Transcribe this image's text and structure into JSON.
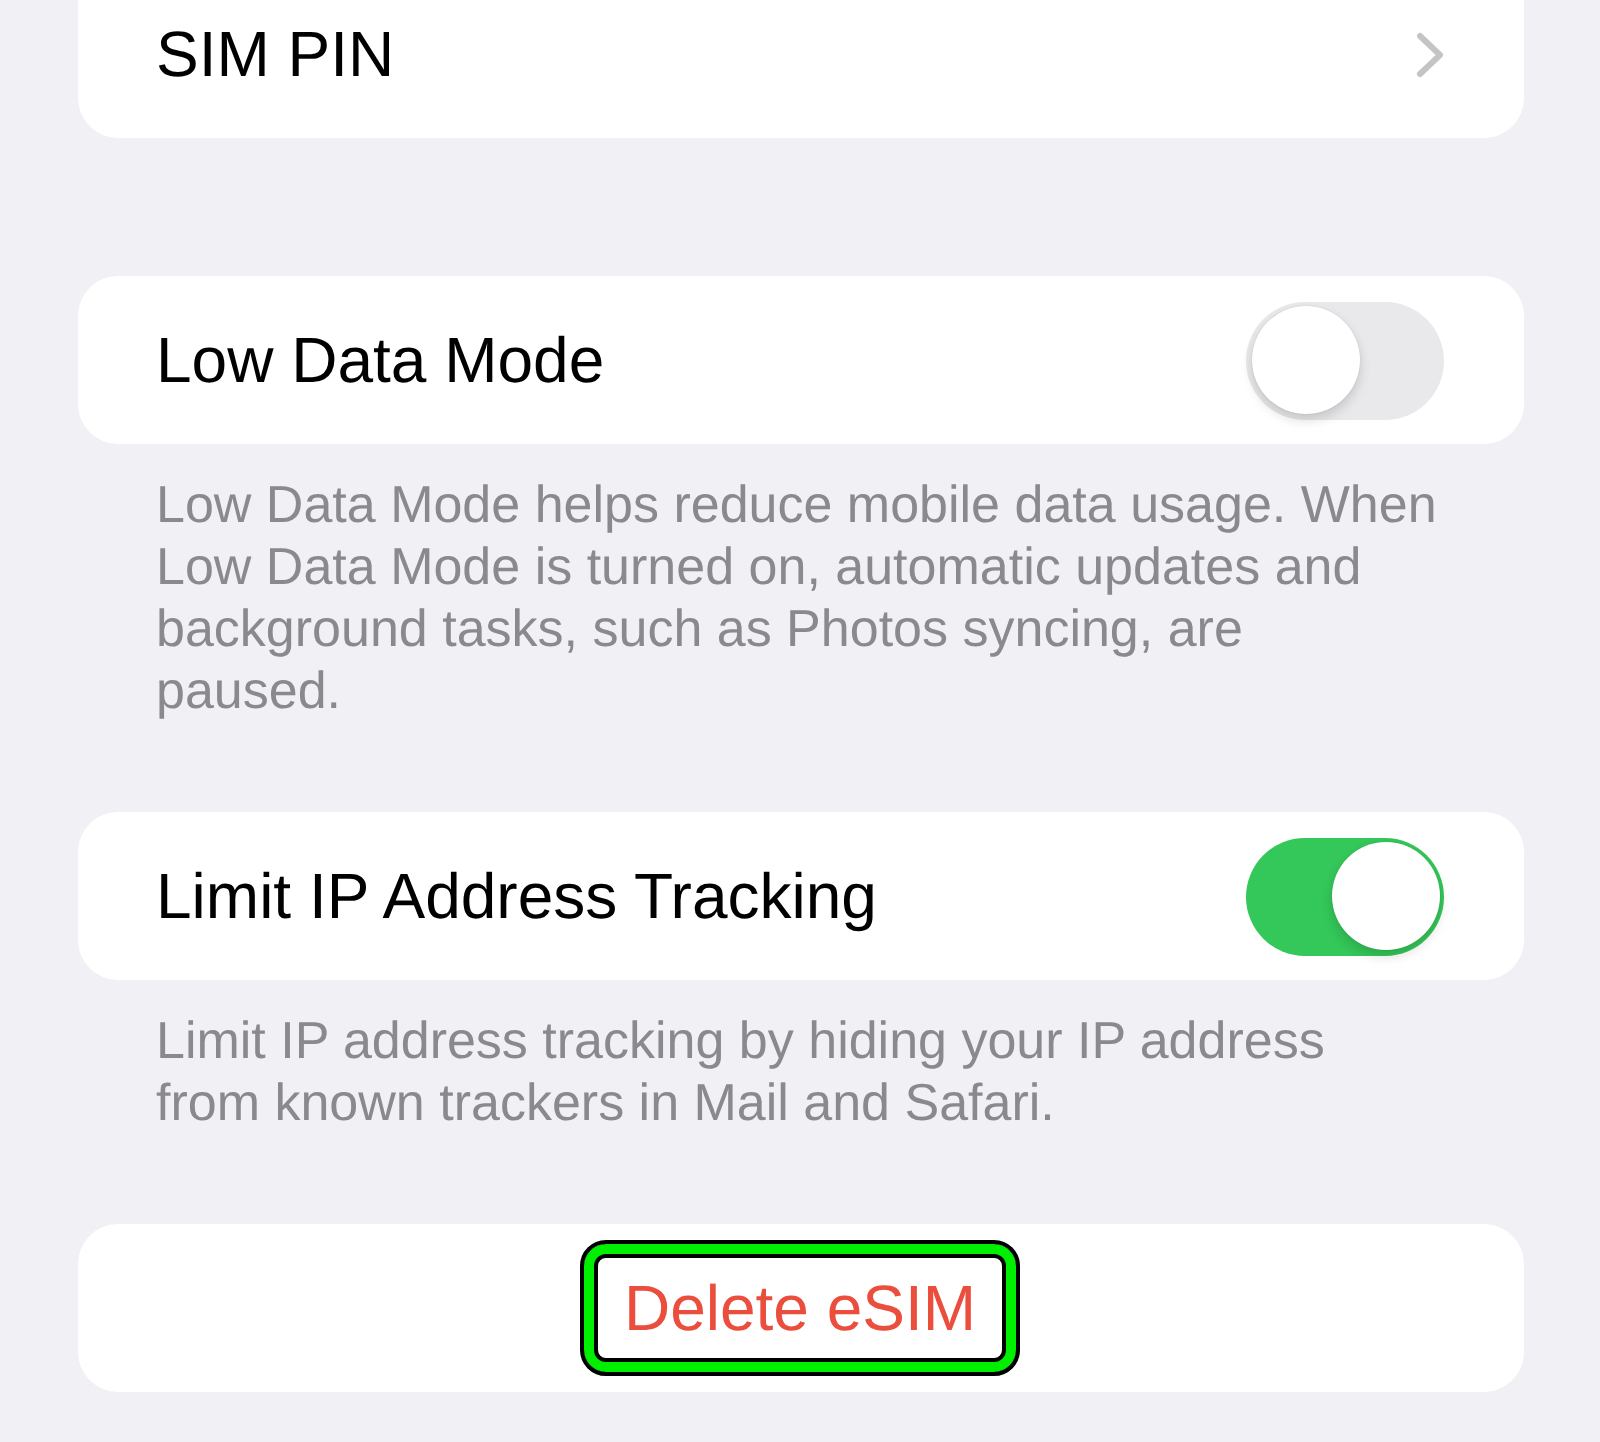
{
  "sections": [
    {
      "kind": "link",
      "label": "SIM PIN"
    },
    {
      "kind": "toggle",
      "label": "Low Data Mode",
      "on": false,
      "footer": "Low Data Mode helps reduce mobile data usage. When Low Data Mode is turned on, automatic updates and background tasks, such as Photos syncing, are paused."
    },
    {
      "kind": "toggle",
      "label": "Limit IP Address Tracking",
      "on": true,
      "footer": "Limit IP address tracking by hiding your IP address from known trackers in Mail and Safari."
    },
    {
      "kind": "action",
      "label": "Delete eSIM",
      "highlighted": true
    }
  ]
}
